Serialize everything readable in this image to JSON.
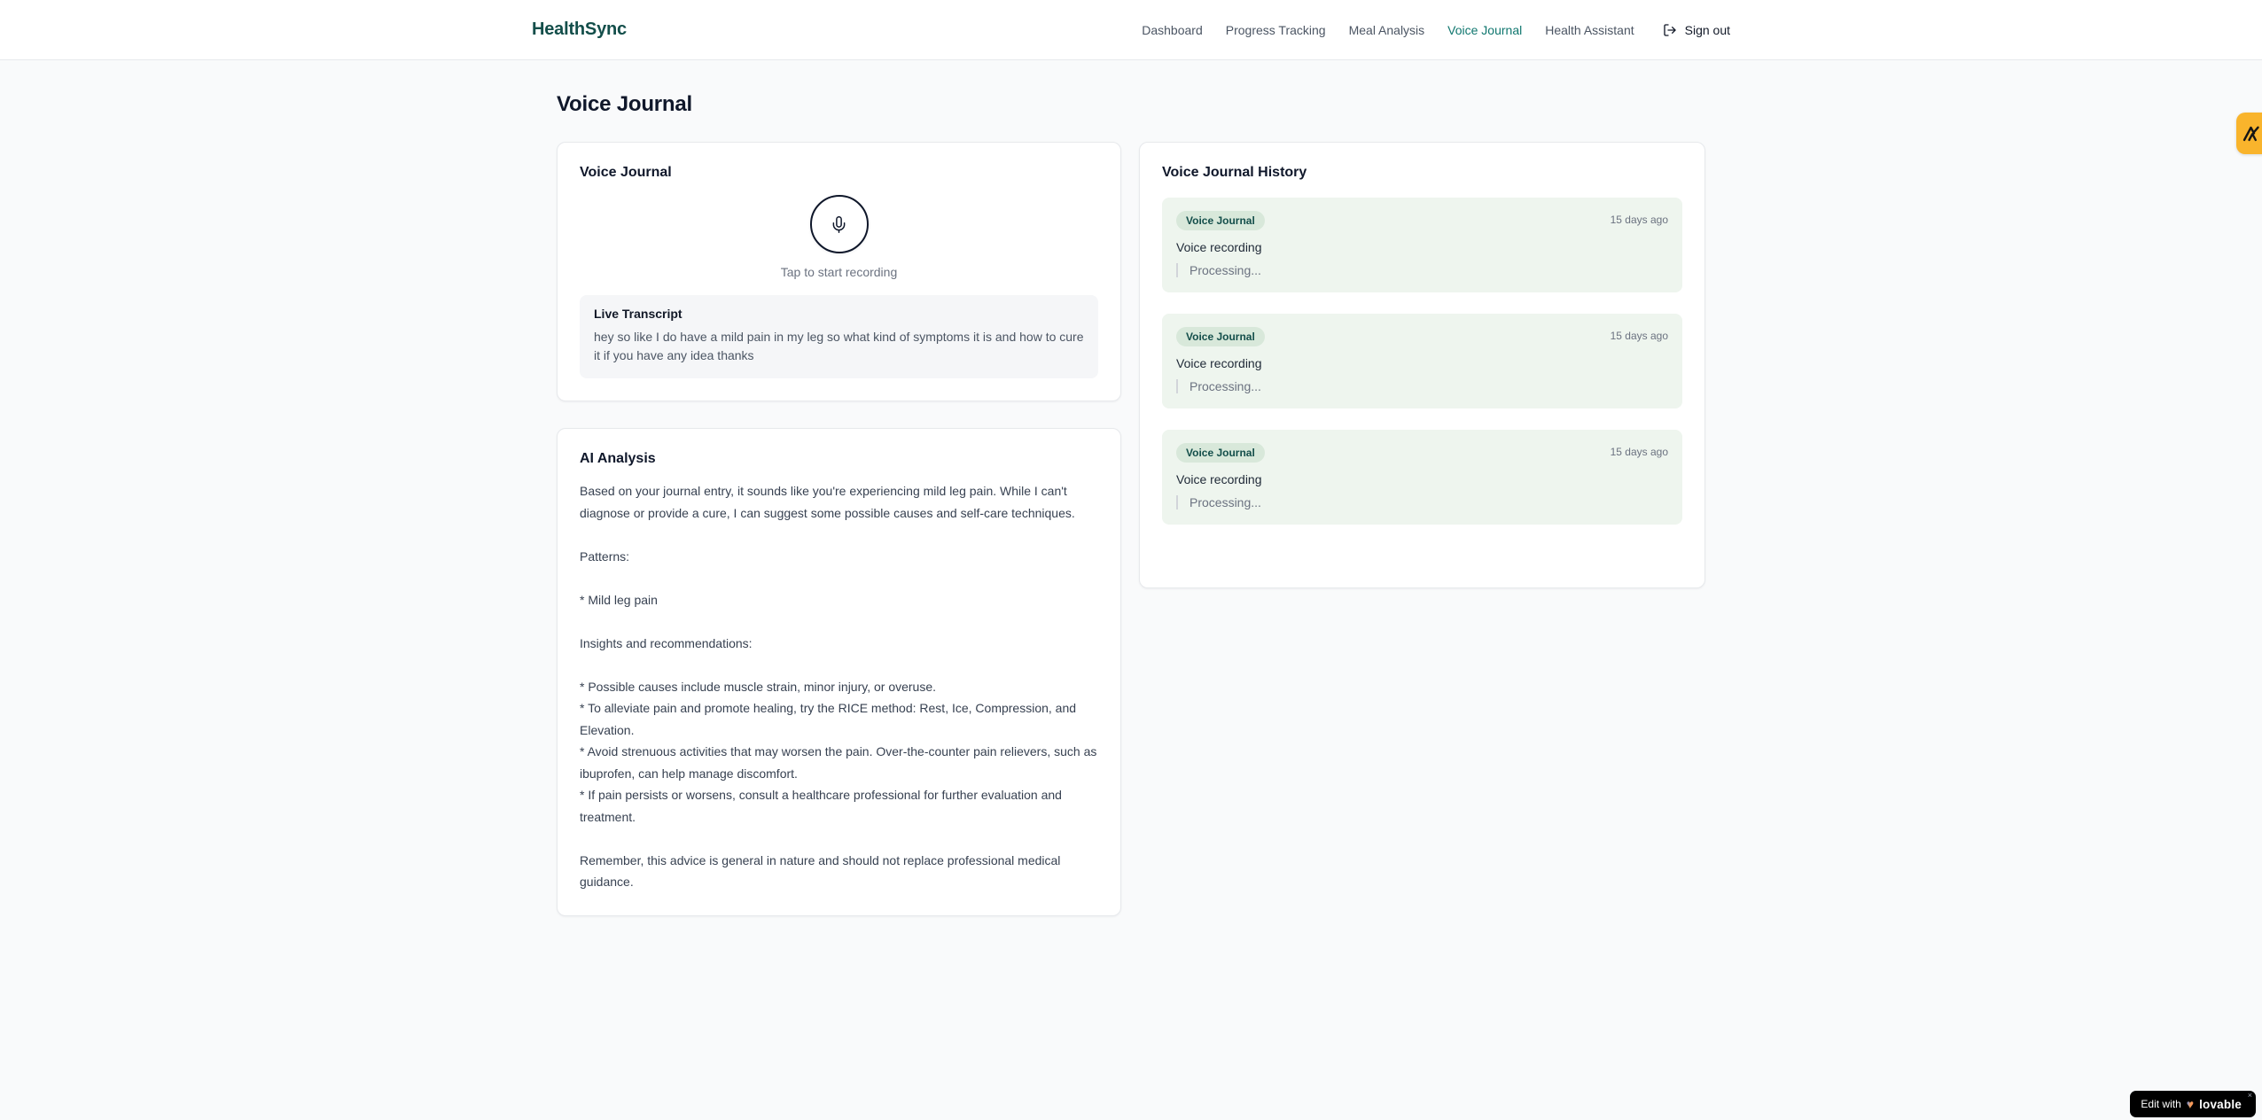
{
  "brand": {
    "name": "HealthSync",
    "color": "#134e4a"
  },
  "nav": {
    "items": [
      {
        "label": "Dashboard",
        "active": false
      },
      {
        "label": "Progress Tracking",
        "active": false
      },
      {
        "label": "Meal Analysis",
        "active": false
      },
      {
        "label": "Voice Journal",
        "active": true
      },
      {
        "label": "Health Assistant",
        "active": false
      }
    ],
    "active_color": "#0f766e",
    "sign_out_label": "Sign out"
  },
  "page": {
    "title": "Voice Journal"
  },
  "recorder": {
    "card_title": "Voice Journal",
    "tap_hint": "Tap to start recording",
    "live_transcript_label": "Live Transcript",
    "live_transcript_text": "hey so like I do have a mild pain in my leg so what kind of symptoms it is and how to cure it if you have any idea thanks"
  },
  "analysis": {
    "card_title": "AI Analysis",
    "body": "Based on your journal entry, it sounds like you're experiencing mild leg pain. While I can't diagnose or provide a cure, I can suggest some possible causes and self-care techniques.\n\nPatterns:\n\n* Mild leg pain\n\nInsights and recommendations:\n\n* Possible causes include muscle strain, minor injury, or overuse.\n* To alleviate pain and promote healing, try the RICE method: Rest, Ice, Compression, and Elevation.\n* Avoid strenuous activities that may worsen the pain. Over-the-counter pain relievers, such as ibuprofen, can help manage discomfort.\n* If pain persists or worsens, consult a healthcare professional for further evaluation and treatment.\n\nRemember, this advice is general in nature and should not replace professional medical guidance."
  },
  "history": {
    "card_title": "Voice Journal History",
    "entry_bg": "#eef5ee",
    "badge_bg": "#d8e8da",
    "badge_text_color": "#134e4a",
    "entries": [
      {
        "type_badge": "Voice Journal",
        "timestamp": "15 days ago",
        "title": "Voice recording",
        "status": "Processing..."
      },
      {
        "type_badge": "Voice Journal",
        "timestamp": "15 days ago",
        "title": "Voice recording",
        "status": "Processing..."
      },
      {
        "type_badge": "Voice Journal",
        "timestamp": "15 days ago",
        "title": "Voice recording",
        "status": "Processing..."
      }
    ]
  },
  "widgets": {
    "side_tab_color": "#f9b42c",
    "lovable": {
      "prefix": "Edit with",
      "brand": "lovable",
      "close": "×"
    }
  }
}
